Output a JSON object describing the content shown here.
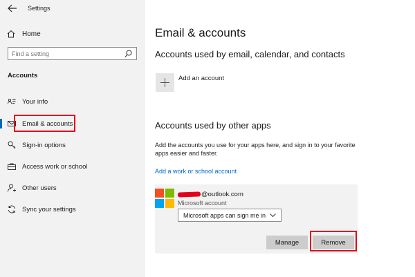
{
  "app": {
    "title": "Settings"
  },
  "sidebar": {
    "home_label": "Home",
    "search_placeholder": "Find a setting",
    "section_label": "Accounts",
    "items": [
      {
        "label": "Your info",
        "icon": "person-card-icon"
      },
      {
        "label": "Email & accounts",
        "icon": "mail-icon",
        "active": true
      },
      {
        "label": "Sign-in options",
        "icon": "key-icon"
      },
      {
        "label": "Access work or school",
        "icon": "briefcase-icon"
      },
      {
        "label": "Other users",
        "icon": "person-add-icon"
      },
      {
        "label": "Sync your settings",
        "icon": "sync-icon"
      }
    ]
  },
  "main": {
    "title": "Email & accounts",
    "section1_heading": "Accounts used by email, calendar, and contacts",
    "add_account_label": "Add an account",
    "section2_heading": "Accounts used by other apps",
    "section2_desc": "Add the accounts you use for your apps here, and sign in to your favorite apps easier and faster.",
    "add_work_link": "Add a work or school account",
    "account": {
      "email_suffix": "@outlook.com",
      "type": "Microsoft account",
      "signin_option": "Microsoft apps can sign me in",
      "manage_label": "Manage",
      "remove_label": "Remove"
    }
  },
  "colors": {
    "accent": "#0067c0",
    "highlight": "#e0001b"
  }
}
